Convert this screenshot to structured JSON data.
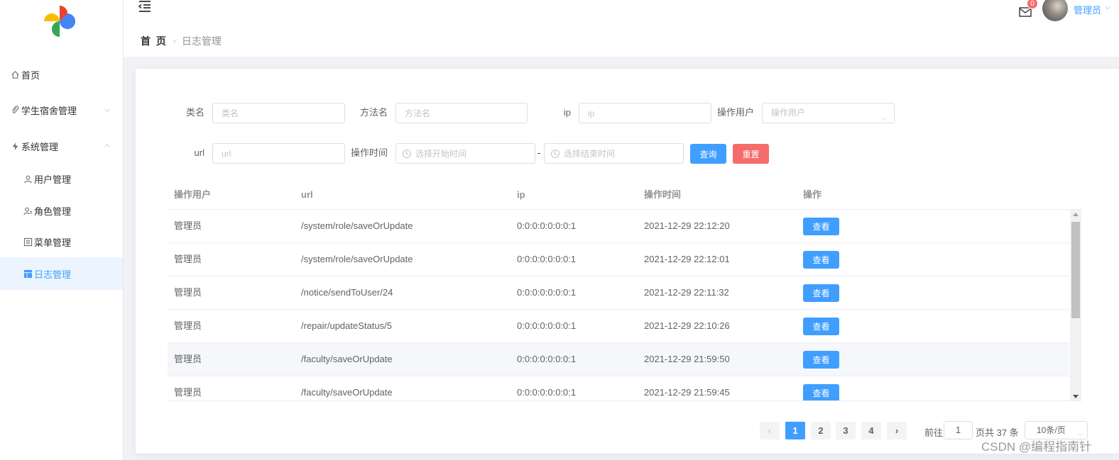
{
  "sidebar": {
    "items": [
      {
        "label": "首页",
        "icon": "home-icon"
      },
      {
        "label": "学生宿舍管理",
        "icon": "paperclip-icon"
      },
      {
        "label": "系统管理",
        "icon": "lightning-icon"
      },
      {
        "label": "用户管理",
        "icon": "user-icon"
      },
      {
        "label": "角色管理",
        "icon": "user-setting-icon"
      },
      {
        "label": "菜单管理",
        "icon": "list-icon"
      },
      {
        "label": "日志管理",
        "icon": "layout-icon"
      }
    ]
  },
  "header": {
    "breadcrumb_home": "首 页",
    "breadcrumb_current": "日志管理",
    "badge": "0",
    "username": "管理员"
  },
  "form": {
    "class_label": "类名",
    "class_placeholder": "类名",
    "method_label": "方法名",
    "method_placeholder": "方法名",
    "ip_label": "ip",
    "ip_placeholder": "ip",
    "user_label": "操作用户",
    "user_placeholder": "操作用户",
    "url_label": "url",
    "url_placeholder": "url",
    "time_label": "操作时间",
    "start_placeholder": "选择开始时间",
    "range_sep": "-",
    "end_placeholder": "选择结束时间",
    "search_button": "查询",
    "reset_button": "重置"
  },
  "table": {
    "columns": [
      "操作用户",
      "url",
      "ip",
      "操作时间",
      "操作"
    ],
    "rows": [
      {
        "user": "管理员",
        "url": "/system/role/saveOrUpdate",
        "ip": "0:0:0:0:0:0:0:1",
        "time": "2021-12-29 22:12:20",
        "action": "查看"
      },
      {
        "user": "管理员",
        "url": "/system/role/saveOrUpdate",
        "ip": "0:0:0:0:0:0:0:1",
        "time": "2021-12-29 22:12:01",
        "action": "查看"
      },
      {
        "user": "管理员",
        "url": "/notice/sendToUser/24",
        "ip": "0:0:0:0:0:0:0:1",
        "time": "2021-12-29 22:11:32",
        "action": "查看"
      },
      {
        "user": "管理员",
        "url": "/repair/updateStatus/5",
        "ip": "0:0:0:0:0:0:0:1",
        "time": "2021-12-29 22:10:26",
        "action": "查看"
      },
      {
        "user": "管理员",
        "url": "/faculty/saveOrUpdate",
        "ip": "0:0:0:0:0:0:0:1",
        "time": "2021-12-29 21:59:50",
        "action": "查看"
      },
      {
        "user": "管理员",
        "url": "/faculty/saveOrUpdate",
        "ip": "0:0:0:0:0:0:0:1",
        "time": "2021-12-29 21:59:45",
        "action": "查看"
      }
    ]
  },
  "pagination": {
    "prev": "‹",
    "pages": [
      "1",
      "2",
      "3",
      "4"
    ],
    "current": "1",
    "next": "›",
    "goto_label": "前往",
    "goto_value": "1",
    "total_text": "页共 37 条",
    "page_size": "10条/页"
  },
  "watermark": "CSDN @编程指南针",
  "colors": {
    "primary": "#409eff",
    "danger": "#f56c6c",
    "active_menu_bg": "#ecf5ff"
  }
}
